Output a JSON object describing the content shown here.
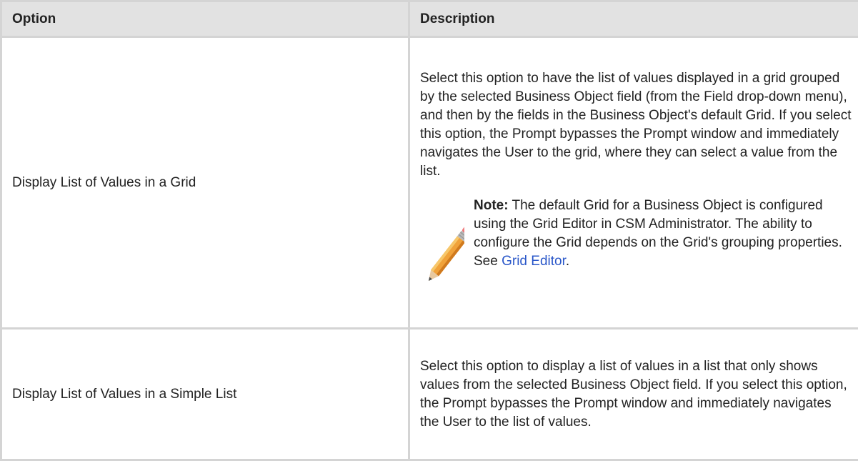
{
  "table": {
    "headers": {
      "option": "Option",
      "description": "Description"
    },
    "rows": [
      {
        "option": "Display List of Values in a Grid",
        "description": "Select this option to have the list of values displayed in a grid grouped by the selected Business Object field (from the Field drop-down menu), and then by the fields in the Business Object's default Grid. If you select this option, the Prompt bypasses the Prompt window and immediately navigates the User to the grid, where they can select a value from the list.",
        "note": {
          "icon": "pencil-icon",
          "label": "Note:",
          "text": "The default Grid for a Business Object is configured using the Grid Editor in CSM Administrator. The ability to configure the Grid depends on the Grid's grouping properties. See",
          "link_text": "Grid Editor",
          "after_link": "."
        }
      },
      {
        "option": "Display List of Values in a Simple List",
        "description": "Select this option to display a list of values in a list that only shows values from the selected Business Object field. If you select this option, the Prompt bypasses the Prompt window and immediately navigates the User to the list of values."
      }
    ]
  },
  "colors": {
    "header_bg": "#e2e2e2",
    "border": "#d4d4d4",
    "link": "#2a57c9"
  }
}
